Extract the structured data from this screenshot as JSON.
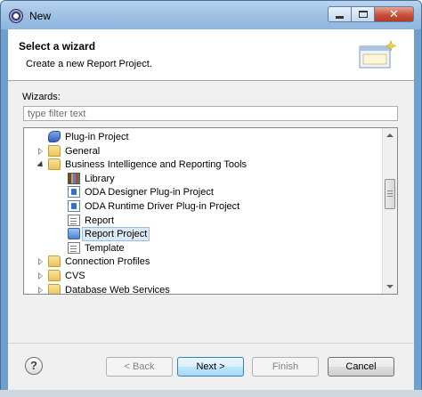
{
  "window": {
    "title": "New"
  },
  "header": {
    "title": "Select a wizard",
    "description": "Create a new Report Project."
  },
  "wizards": {
    "label": "Wizards:",
    "filter_placeholder": "type filter text",
    "tree": [
      {
        "label": "Plug-in Project",
        "icon": "plugin-project-icon",
        "twisty": "none",
        "level": 0
      },
      {
        "label": "General",
        "icon": "folder-icon",
        "twisty": "closed",
        "level": 0
      },
      {
        "label": "Business Intelligence and Reporting Tools",
        "icon": "folder-open-icon",
        "twisty": "open",
        "level": 0
      },
      {
        "label": "Library",
        "icon": "library-icon",
        "twisty": "none",
        "level": 1
      },
      {
        "label": "ODA Designer Plug-in Project",
        "icon": "oda-designer-icon",
        "twisty": "none",
        "level": 1
      },
      {
        "label": "ODA Runtime Driver Plug-in Project",
        "icon": "oda-runtime-icon",
        "twisty": "none",
        "level": 1
      },
      {
        "label": "Report",
        "icon": "report-icon",
        "twisty": "none",
        "level": 1
      },
      {
        "label": "Report Project",
        "icon": "report-project-icon",
        "twisty": "none",
        "level": 1,
        "selected": true
      },
      {
        "label": "Template",
        "icon": "template-icon",
        "twisty": "none",
        "level": 1
      },
      {
        "label": "Connection Profiles",
        "icon": "folder-icon",
        "twisty": "closed",
        "level": 0
      },
      {
        "label": "CVS",
        "icon": "folder-icon",
        "twisty": "closed",
        "level": 0
      },
      {
        "label": "Database Web Services",
        "icon": "folder-icon",
        "twisty": "closed",
        "level": 0
      }
    ]
  },
  "buttons": {
    "help": "?",
    "back": "< Back",
    "next": "Next >",
    "finish": "Finish",
    "cancel": "Cancel"
  },
  "colors": {
    "selection_bg": "#dce8f6",
    "default_button": "#bee6fd",
    "title_bar": "#9fc1e4"
  }
}
